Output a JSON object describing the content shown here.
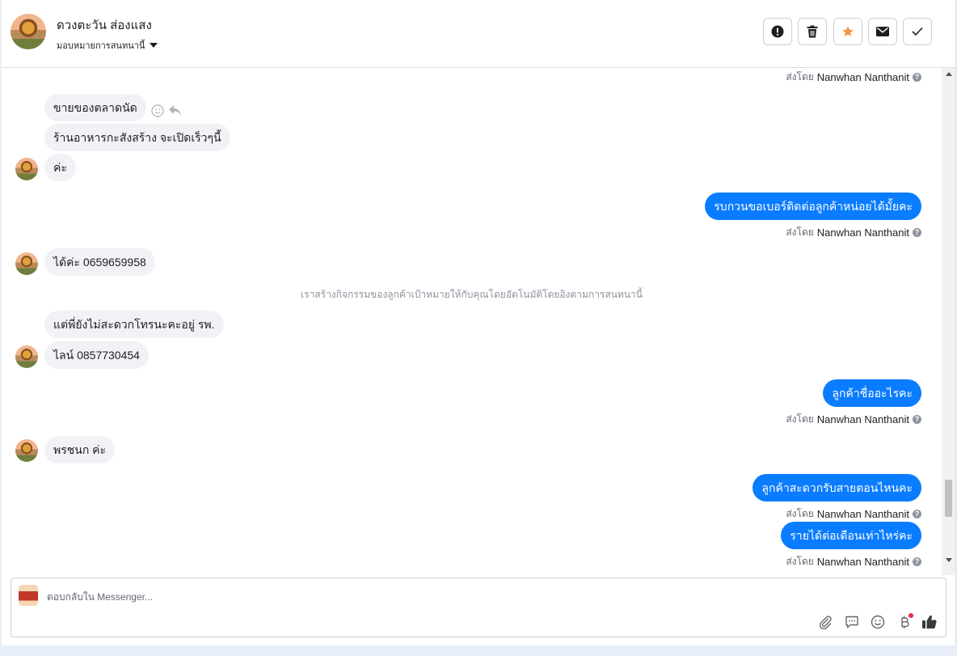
{
  "header": {
    "contact_name": "ดวงตะวัน ส่องแสง",
    "assign_label": "มอบหมายการสนทนานี้",
    "actions": [
      {
        "name": "report-button",
        "icon": "exclamation-circle-icon"
      },
      {
        "name": "delete-button",
        "icon": "trash-icon"
      },
      {
        "name": "star-button",
        "icon": "star-icon",
        "color": "#f7923a"
      },
      {
        "name": "email-button",
        "icon": "envelope-icon"
      },
      {
        "name": "done-button",
        "icon": "checkmark-icon"
      }
    ]
  },
  "thread": {
    "sent_by_prefix": "ส่งโดย",
    "agent_name": "Nanwhan Nanthanit",
    "system_note": "เราสร้างกิจกรรมของลูกค้าเป้าหมายให้กับคุณโดยอัตโนมัติโดยอิงตามการสนทนานี้",
    "messages": [
      {
        "dir": "in",
        "text": "ขายของตลาดนัด"
      },
      {
        "dir": "in",
        "text": "ร้านอาหารกะสังสร้าง จะเปิดเร็วๆนี้"
      },
      {
        "dir": "in",
        "text": "ค่ะ"
      },
      {
        "dir": "out",
        "text": "รบกวนขอเบอร์ติดต่อลูกค้าหน่อยได้มั้ยคะ"
      },
      {
        "dir": "in",
        "text": "ได้ค่ะ 0659659958"
      },
      {
        "dir": "in",
        "text": "แต่พี่ยังไม่สะดวกโทรนะคะอยู่ รพ."
      },
      {
        "dir": "in",
        "text": "ไลน์ 0857730454"
      },
      {
        "dir": "out",
        "text": "ลูกค้าชื่ออะไรคะ"
      },
      {
        "dir": "in",
        "text": "พรชนก ค่ะ"
      },
      {
        "dir": "out",
        "text": "ลูกค้าสะดวกรับสายตอนไหนคะ"
      },
      {
        "dir": "out",
        "text": "รายได้ต่อเดือนเท่าไหร่คะ"
      }
    ]
  },
  "composer": {
    "placeholder": "ตอบกลับใน Messenger...",
    "tools": [
      "paperclip-icon",
      "saved-reply-icon",
      "emoji-icon",
      "baht-icon",
      "thumbs-up-icon"
    ]
  },
  "colors": {
    "outgoing_bubble": "#0a7cff",
    "incoming_bubble": "#f0f2f5",
    "star": "#f7923a"
  }
}
